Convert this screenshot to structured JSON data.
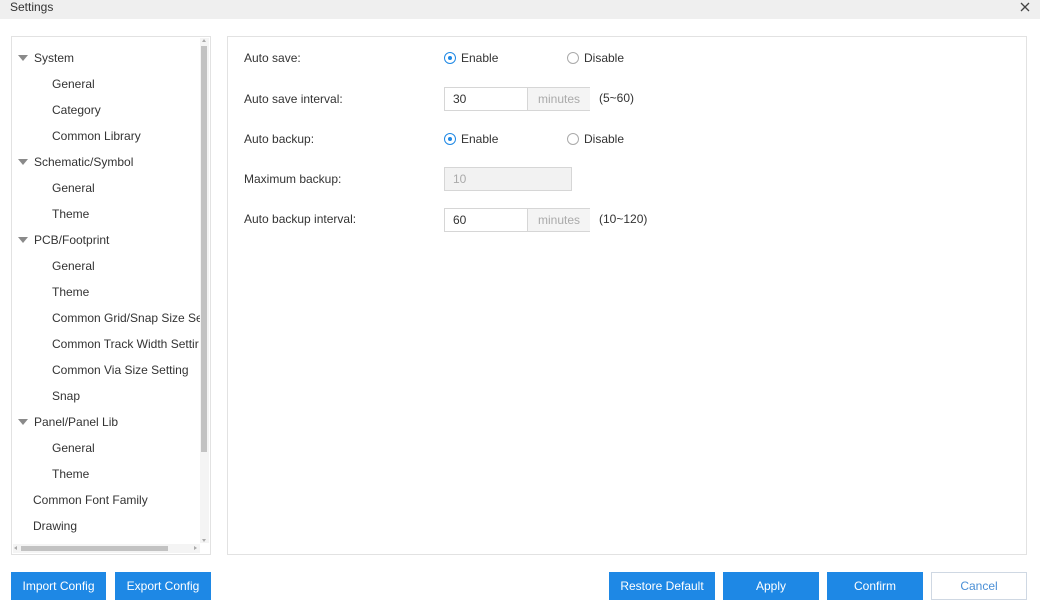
{
  "window": {
    "title": "Settings"
  },
  "tree": [
    {
      "label": "System",
      "level": 0,
      "expanded": true
    },
    {
      "label": "General",
      "level": 1
    },
    {
      "label": "Category",
      "level": 1
    },
    {
      "label": "Common Library",
      "level": 1
    },
    {
      "label": "Schematic/Symbol",
      "level": 0,
      "expanded": true
    },
    {
      "label": "General",
      "level": 1
    },
    {
      "label": "Theme",
      "level": 1
    },
    {
      "label": "PCB/Footprint",
      "level": 0,
      "expanded": true
    },
    {
      "label": "General",
      "level": 1
    },
    {
      "label": "Theme",
      "level": 1
    },
    {
      "label": "Common Grid/Snap Size Se",
      "level": 1
    },
    {
      "label": "Common Track Width Settir",
      "level": 1
    },
    {
      "label": "Common Via Size Setting",
      "level": 1
    },
    {
      "label": "Snap",
      "level": 1
    },
    {
      "label": "Panel/Panel Lib",
      "level": 0,
      "expanded": true
    },
    {
      "label": "General",
      "level": 1
    },
    {
      "label": "Theme",
      "level": 1
    },
    {
      "label": "Common Font Family",
      "level": 0,
      "leaf": true
    },
    {
      "label": "Drawing",
      "level": 0,
      "leaf": true
    }
  ],
  "settings": {
    "auto_save": {
      "label": "Auto save:",
      "enable": "Enable",
      "disable": "Disable",
      "selected": "Enable"
    },
    "auto_save_interval": {
      "label": "Auto save interval:",
      "value": "30",
      "unit": "minutes",
      "hint": "(5~60)"
    },
    "auto_backup": {
      "label": "Auto backup:",
      "enable": "Enable",
      "disable": "Disable",
      "selected": "Enable"
    },
    "maximum_backup": {
      "label": "Maximum backup:",
      "value": "10",
      "disabled": true
    },
    "auto_backup_interval": {
      "label": "Auto backup interval:",
      "value": "60",
      "unit": "minutes",
      "hint": "(10~120)"
    }
  },
  "buttons": {
    "import": "Import Config",
    "export": "Export Config",
    "restore": "Restore Default",
    "apply": "Apply",
    "confirm": "Confirm",
    "cancel": "Cancel"
  },
  "colors": {
    "accent": "#1e88e5",
    "border": "#e2e2e2"
  },
  "icons": {
    "close": "close-icon",
    "expand": "caret-down-icon"
  }
}
